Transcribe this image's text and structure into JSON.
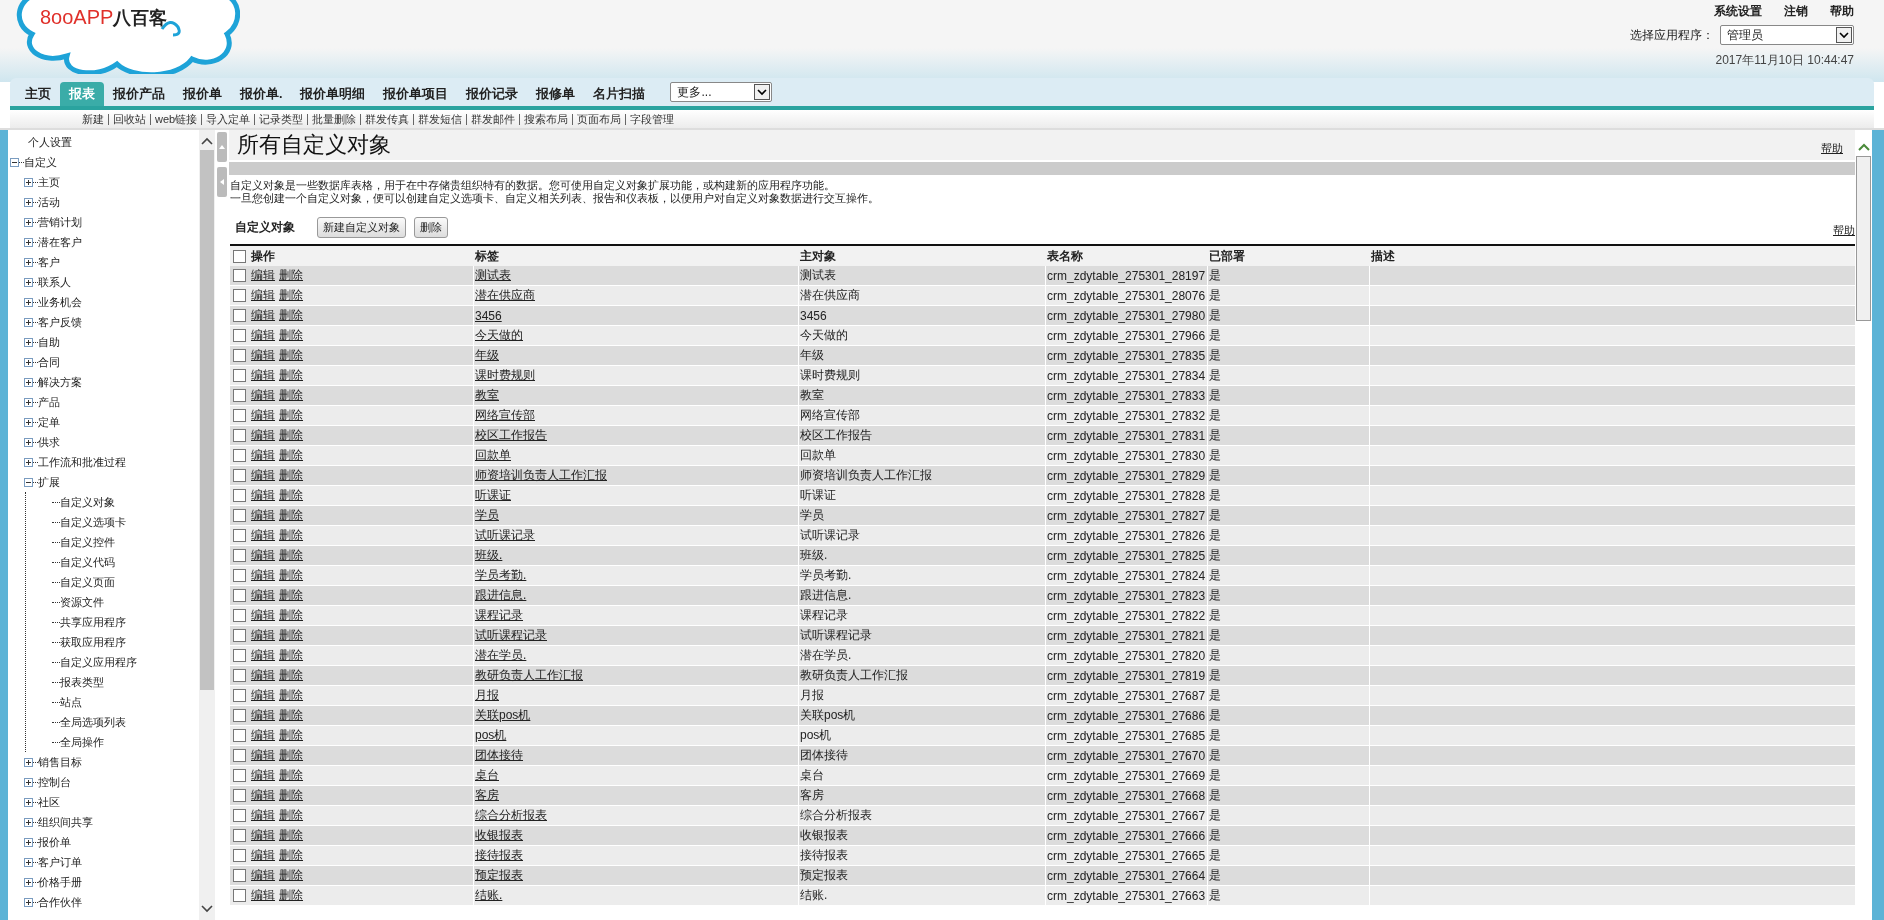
{
  "logo": {
    "brand_latin": "8ooAPP",
    "brand_cjk": "八百客"
  },
  "top_links": [
    "系统设置",
    "注销",
    "帮助"
  ],
  "app_selector": {
    "label": "选择应用程序：",
    "value": "管理员"
  },
  "datetime": "2017年11月10日 10:44:47",
  "tabs": [
    {
      "label": "主页",
      "selected": false
    },
    {
      "label": "报表",
      "selected": true
    },
    {
      "label": "报价产品",
      "selected": false
    },
    {
      "label": "报价单",
      "selected": false
    },
    {
      "label": "报价单.",
      "selected": false
    },
    {
      "label": "报价单明细",
      "selected": false
    },
    {
      "label": "报价单项目",
      "selected": false
    },
    {
      "label": "报价记录",
      "selected": false
    },
    {
      "label": "报修单",
      "selected": false
    },
    {
      "label": "名片扫描",
      "selected": false
    }
  ],
  "more_select": {
    "value": "更多..."
  },
  "subnav": [
    "新建",
    "回收站",
    "web链接",
    "导入定单",
    "记录类型",
    "批量删除",
    "群发传真",
    "群发短信",
    "群发邮件",
    "搜索布局",
    "页面布局",
    "字段管理"
  ],
  "sidebar": {
    "items": [
      {
        "label": "个人设置"
      },
      {
        "label": "自定义",
        "expanded": true,
        "children": [
          {
            "label": "主页",
            "expanded": false
          },
          {
            "label": "活动",
            "expanded": false
          },
          {
            "label": "营销计划",
            "expanded": false
          },
          {
            "label": "潜在客户",
            "expanded": false
          },
          {
            "label": "客户",
            "expanded": false
          },
          {
            "label": "联系人",
            "expanded": false
          },
          {
            "label": "业务机会",
            "expanded": false
          },
          {
            "label": "客户反馈",
            "expanded": false
          },
          {
            "label": "自助",
            "expanded": false
          },
          {
            "label": "合同",
            "expanded": false
          },
          {
            "label": "解决方案",
            "expanded": false
          },
          {
            "label": "产品",
            "expanded": false
          },
          {
            "label": "定单",
            "expanded": false
          },
          {
            "label": "供求",
            "expanded": false
          },
          {
            "label": "工作流和批准过程",
            "expanded": false
          },
          {
            "label": "扩展",
            "expanded": true,
            "children": [
              {
                "label": "自定义对象"
              },
              {
                "label": "自定义选项卡"
              },
              {
                "label": "自定义控件"
              },
              {
                "label": "自定义代码"
              },
              {
                "label": "自定义页面"
              },
              {
                "label": "资源文件"
              },
              {
                "label": "共享应用程序"
              },
              {
                "label": "获取应用程序"
              },
              {
                "label": "自定义应用程序"
              },
              {
                "label": "报表类型"
              },
              {
                "label": "站点"
              },
              {
                "label": "全局选项列表"
              },
              {
                "label": "全局操作"
              }
            ]
          },
          {
            "label": "销售目标",
            "expanded": false
          },
          {
            "label": "控制台",
            "expanded": false
          },
          {
            "label": "社区",
            "expanded": false
          },
          {
            "label": "组织间共享",
            "expanded": false
          },
          {
            "label": "报价单",
            "expanded": false
          },
          {
            "label": "客户订单",
            "expanded": false
          },
          {
            "label": "价格手册",
            "expanded": false
          },
          {
            "label": "合作伙伴",
            "expanded": false
          }
        ]
      }
    ]
  },
  "page": {
    "title": "所有自定义对象",
    "help": "帮助",
    "description": [
      "自定义对象是一些数据库表格，用于在中存储贵组织特有的数据。您可使用自定义对象扩展功能，或构建新的应用程序功能。",
      "一旦您创建一个自定义对象，便可以创建自定义选项卡、自定义相关列表、报告和仪表板，以便用户对自定义对象数据进行交互操作。"
    ],
    "section_title": "自定义对象",
    "buttons": [
      "新建自定义对象",
      "删除"
    ],
    "section_help": "帮助"
  },
  "table": {
    "select_all_checked": false,
    "columns": [
      "操作",
      "标签",
      "主对象",
      "表名称",
      "已部署",
      "描述"
    ],
    "rows": [
      {
        "checked": false,
        "actions": [
          "编辑",
          "删除"
        ],
        "label": "测试表",
        "master": "测试表",
        "table_name": "crm_zdytable_275301_28197",
        "deployed": "是"
      },
      {
        "checked": false,
        "actions": [
          "编辑",
          "删除"
        ],
        "label": "潜在供应商",
        "master": "潜在供应商",
        "table_name": "crm_zdytable_275301_28076",
        "deployed": "是"
      },
      {
        "checked": false,
        "actions": [
          "编辑",
          "删除"
        ],
        "label": "3456",
        "master": "3456",
        "table_name": "crm_zdytable_275301_27980",
        "deployed": "是"
      },
      {
        "checked": false,
        "actions": [
          "编辑",
          "删除"
        ],
        "label": "今天做的",
        "master": "今天做的",
        "table_name": "crm_zdytable_275301_27966",
        "deployed": "是"
      },
      {
        "checked": false,
        "actions": [
          "编辑",
          "删除"
        ],
        "label": "年级",
        "master": "年级",
        "table_name": "crm_zdytable_275301_27835",
        "deployed": "是"
      },
      {
        "checked": false,
        "actions": [
          "编辑",
          "删除"
        ],
        "label": "课时费规则",
        "master": "课时费规则",
        "table_name": "crm_zdytable_275301_27834",
        "deployed": "是"
      },
      {
        "checked": false,
        "actions": [
          "编辑",
          "删除"
        ],
        "label": "教室",
        "master": "教室",
        "table_name": "crm_zdytable_275301_27833",
        "deployed": "是"
      },
      {
        "checked": false,
        "actions": [
          "编辑",
          "删除"
        ],
        "label": "网络宣传部",
        "master": "网络宣传部",
        "table_name": "crm_zdytable_275301_27832",
        "deployed": "是"
      },
      {
        "checked": false,
        "actions": [
          "编辑",
          "删除"
        ],
        "label": "校区工作报告",
        "master": "校区工作报告",
        "table_name": "crm_zdytable_275301_27831",
        "deployed": "是"
      },
      {
        "checked": false,
        "actions": [
          "编辑",
          "删除"
        ],
        "label": "回款单",
        "master": "回款单",
        "table_name": "crm_zdytable_275301_27830",
        "deployed": "是"
      },
      {
        "checked": false,
        "actions": [
          "编辑",
          "删除"
        ],
        "label": "师资培训负责人工作汇报",
        "master": "师资培训负责人工作汇报",
        "table_name": "crm_zdytable_275301_27829",
        "deployed": "是"
      },
      {
        "checked": false,
        "actions": [
          "编辑",
          "删除"
        ],
        "label": "听课证",
        "master": "听课证",
        "table_name": "crm_zdytable_275301_27828",
        "deployed": "是"
      },
      {
        "checked": false,
        "actions": [
          "编辑",
          "删除"
        ],
        "label": "学员",
        "master": "学员",
        "table_name": "crm_zdytable_275301_27827",
        "deployed": "是"
      },
      {
        "checked": false,
        "actions": [
          "编辑",
          "删除"
        ],
        "label": "试听课记录",
        "master": "试听课记录",
        "table_name": "crm_zdytable_275301_27826",
        "deployed": "是"
      },
      {
        "checked": false,
        "actions": [
          "编辑",
          "删除"
        ],
        "label": "班级.",
        "master": "班级.",
        "table_name": "crm_zdytable_275301_27825",
        "deployed": "是"
      },
      {
        "checked": false,
        "actions": [
          "编辑",
          "删除"
        ],
        "label": "学员考勤.",
        "master": "学员考勤.",
        "table_name": "crm_zdytable_275301_27824",
        "deployed": "是"
      },
      {
        "checked": false,
        "actions": [
          "编辑",
          "删除"
        ],
        "label": "跟进信息.",
        "master": "跟进信息.",
        "table_name": "crm_zdytable_275301_27823",
        "deployed": "是"
      },
      {
        "checked": false,
        "actions": [
          "编辑",
          "删除"
        ],
        "label": "课程记录",
        "master": "课程记录",
        "table_name": "crm_zdytable_275301_27822",
        "deployed": "是"
      },
      {
        "checked": false,
        "actions": [
          "编辑",
          "删除"
        ],
        "label": "试听课程记录",
        "master": "试听课程记录",
        "table_name": "crm_zdytable_275301_27821",
        "deployed": "是"
      },
      {
        "checked": false,
        "actions": [
          "编辑",
          "删除"
        ],
        "label": "潜在学员.",
        "master": "潜在学员.",
        "table_name": "crm_zdytable_275301_27820",
        "deployed": "是"
      },
      {
        "checked": false,
        "actions": [
          "编辑",
          "删除"
        ],
        "label": "教研负责人工作汇报",
        "master": "教研负责人工作汇报",
        "table_name": "crm_zdytable_275301_27819",
        "deployed": "是"
      },
      {
        "checked": false,
        "actions": [
          "编辑",
          "删除"
        ],
        "label": "月报",
        "master": "月报",
        "table_name": "crm_zdytable_275301_27687",
        "deployed": "是"
      },
      {
        "checked": false,
        "actions": [
          "编辑",
          "删除"
        ],
        "label": "关联pos机",
        "master": "关联pos机",
        "table_name": "crm_zdytable_275301_27686",
        "deployed": "是"
      },
      {
        "checked": false,
        "actions": [
          "编辑",
          "删除"
        ],
        "label": "pos机",
        "master": "pos机",
        "table_name": "crm_zdytable_275301_27685",
        "deployed": "是"
      },
      {
        "checked": false,
        "actions": [
          "编辑",
          "删除"
        ],
        "label": "团体接待",
        "master": "团体接待",
        "table_name": "crm_zdytable_275301_27670",
        "deployed": "是"
      },
      {
        "checked": false,
        "actions": [
          "编辑",
          "删除"
        ],
        "label": "桌台",
        "master": "桌台",
        "table_name": "crm_zdytable_275301_27669",
        "deployed": "是"
      },
      {
        "checked": false,
        "actions": [
          "编辑",
          "删除"
        ],
        "label": "客房",
        "master": "客房",
        "table_name": "crm_zdytable_275301_27668",
        "deployed": "是"
      },
      {
        "checked": false,
        "actions": [
          "编辑",
          "删除"
        ],
        "label": "综合分析报表",
        "master": "综合分析报表",
        "table_name": "crm_zdytable_275301_27667",
        "deployed": "是"
      },
      {
        "checked": false,
        "actions": [
          "编辑",
          "删除"
        ],
        "label": "收银报表",
        "master": "收银报表",
        "table_name": "crm_zdytable_275301_27666",
        "deployed": "是"
      },
      {
        "checked": false,
        "actions": [
          "编辑",
          "删除"
        ],
        "label": "接待报表",
        "master": "接待报表",
        "table_name": "crm_zdytable_275301_27665",
        "deployed": "是"
      },
      {
        "checked": false,
        "actions": [
          "编辑",
          "删除"
        ],
        "label": "预定报表",
        "master": "预定报表",
        "table_name": "crm_zdytable_275301_27664",
        "deployed": "是"
      },
      {
        "checked": false,
        "actions": [
          "编辑",
          "删除"
        ],
        "label": "结账.",
        "master": "结账.",
        "table_name": "crm_zdytable_275301_27663",
        "deployed": "是"
      }
    ]
  }
}
